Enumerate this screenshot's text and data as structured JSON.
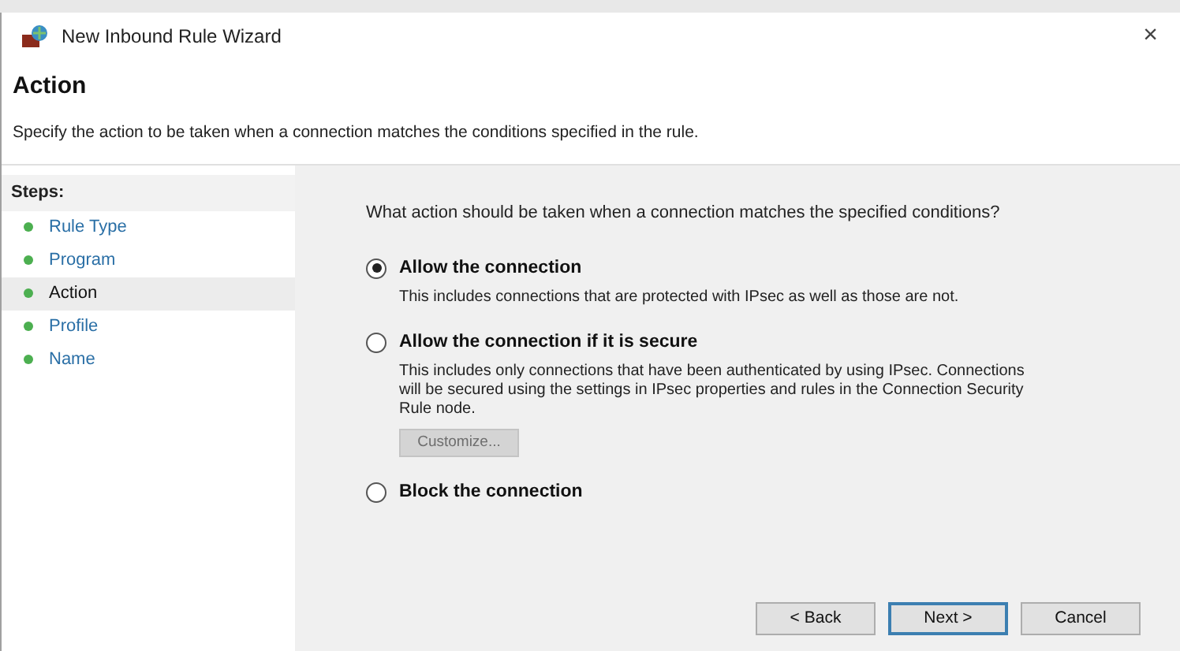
{
  "window": {
    "title": "New Inbound Rule Wizard",
    "close": "×"
  },
  "header": {
    "title": "Action",
    "description": "Specify the action to be taken when a connection matches the conditions specified in the rule."
  },
  "steps": {
    "heading": "Steps:",
    "items": [
      {
        "label": "Rule Type",
        "selected": false
      },
      {
        "label": "Program",
        "selected": false
      },
      {
        "label": "Action",
        "selected": true
      },
      {
        "label": "Profile",
        "selected": false
      },
      {
        "label": "Name",
        "selected": false
      }
    ]
  },
  "question": "What action should be taken when a connection matches the specified conditions?",
  "options": [
    {
      "label": "Allow the connection",
      "selected": true,
      "description": "This includes connections that are protected with IPsec as well as those are not."
    },
    {
      "label": "Allow the connection if it is secure",
      "selected": false,
      "description": "This includes only connections that have been authenticated by using IPsec.  Connections will be secured using the settings in IPsec properties and rules in the Connection Security Rule node.",
      "button": {
        "label": "Customize...",
        "disabled": true
      }
    },
    {
      "label": "Block the connection",
      "selected": false
    }
  ],
  "buttons": [
    {
      "label": "< Back",
      "default": false
    },
    {
      "label": "Next >",
      "default": true
    },
    {
      "label": "Cancel",
      "default": false
    }
  ]
}
